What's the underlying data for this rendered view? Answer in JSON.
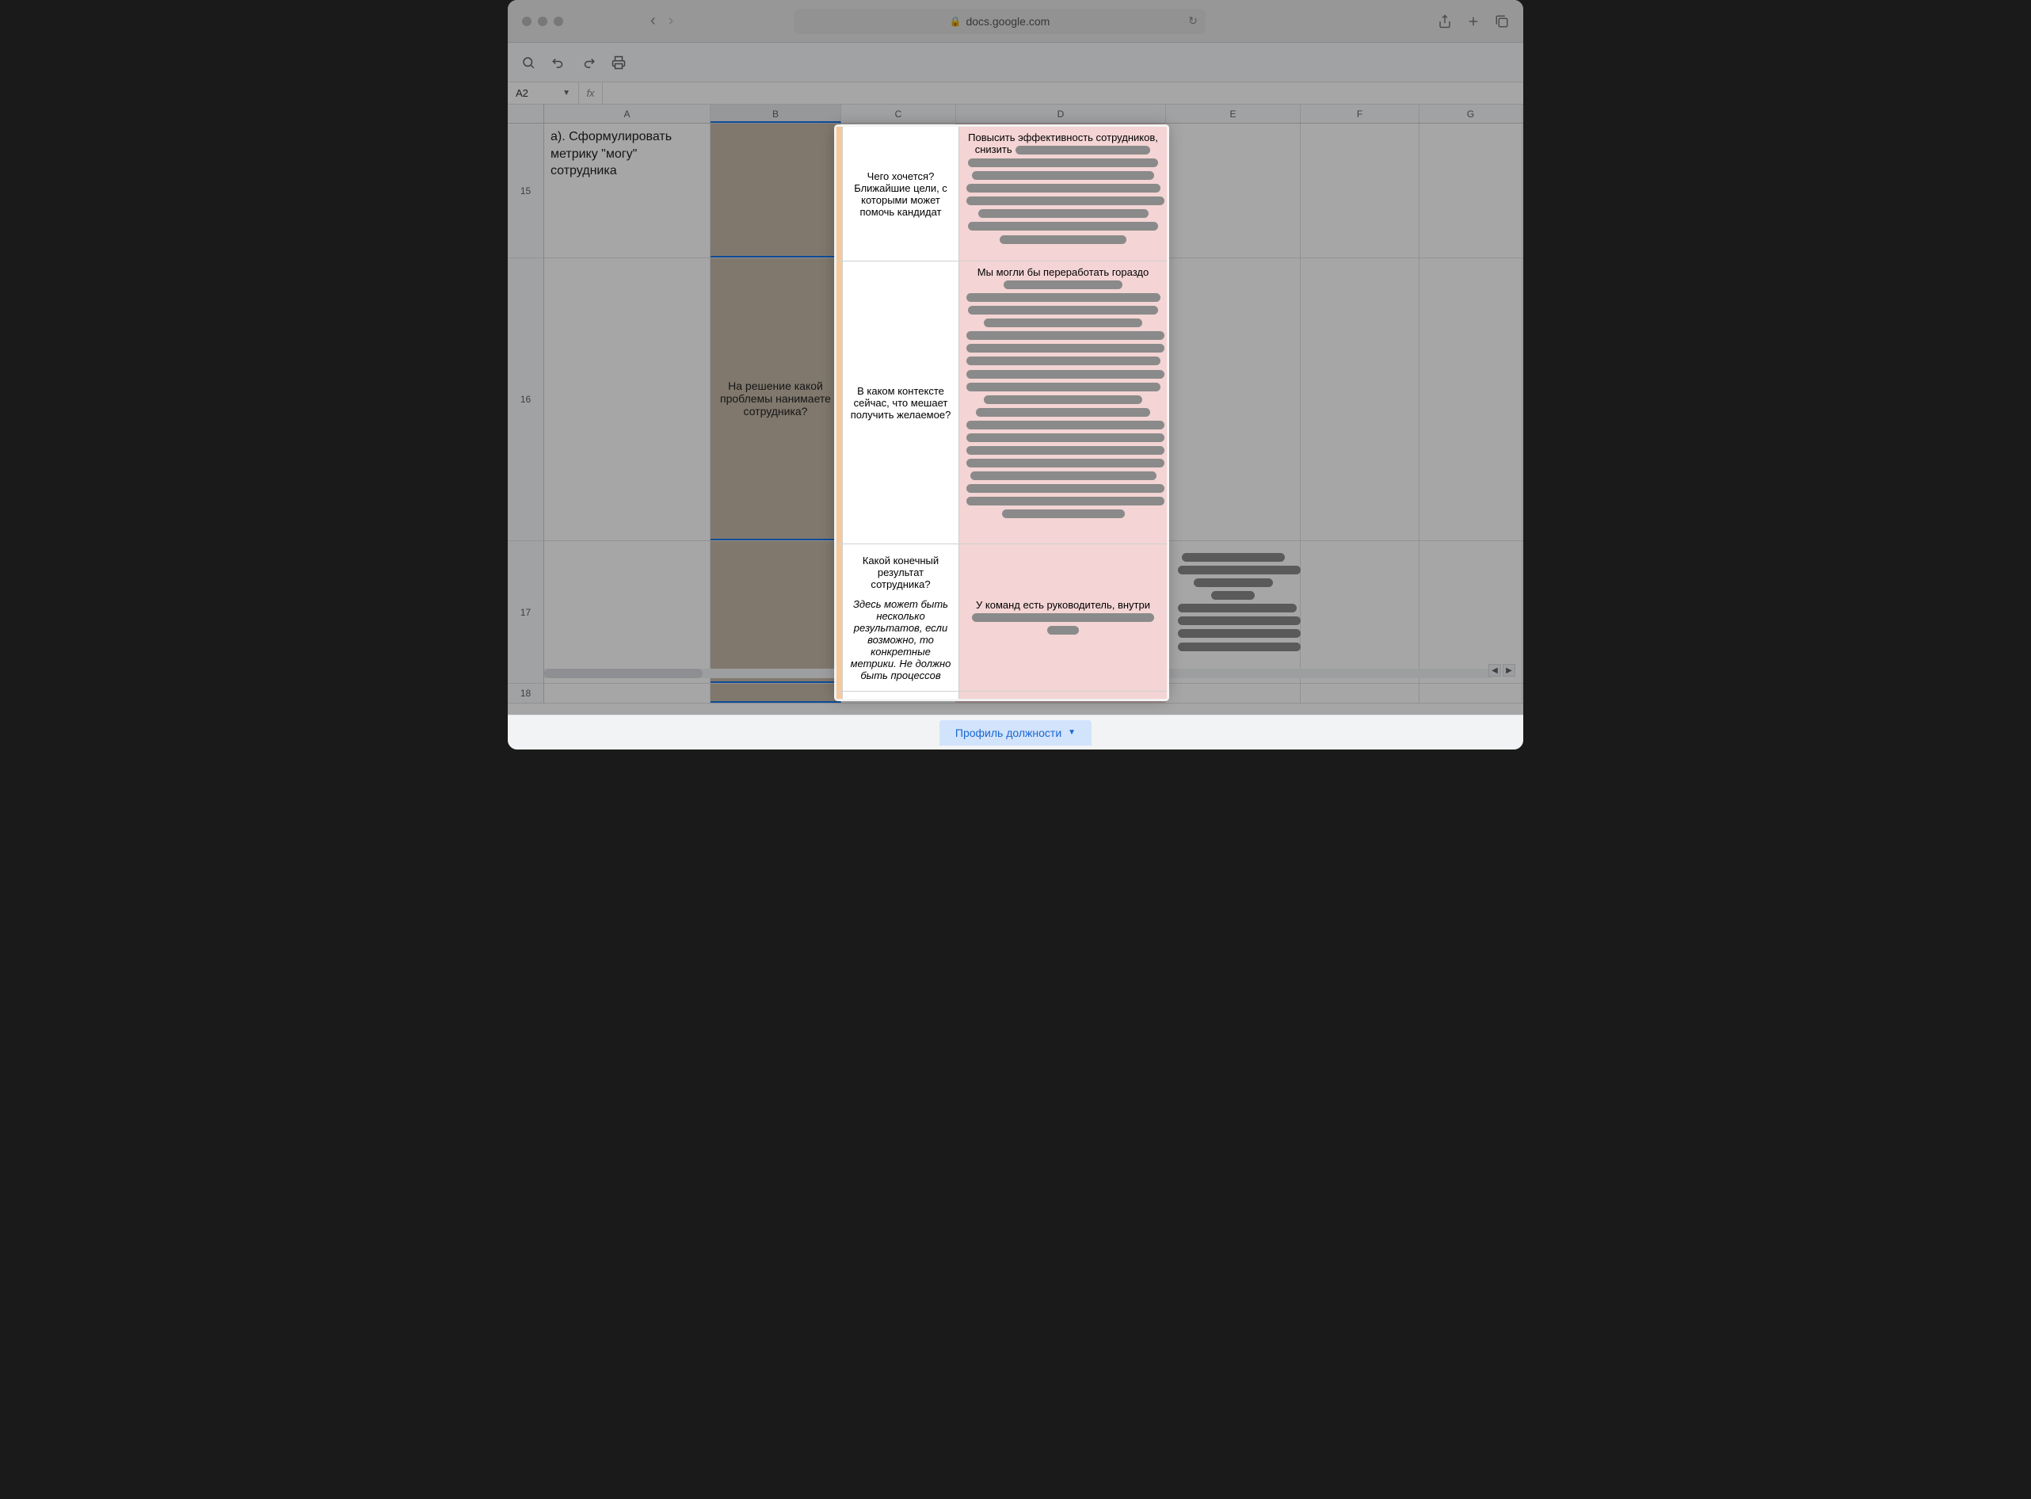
{
  "browser": {
    "url": "docs.google.com"
  },
  "namebox": {
    "ref": "A2"
  },
  "columns": [
    "A",
    "B",
    "C",
    "D",
    "E",
    "F",
    "G"
  ],
  "rows": [
    "15",
    "16",
    "17",
    "18"
  ],
  "cells": {
    "a15": "a). Сформулировать метрику \"могу\" сотрудника",
    "b16": "На решение какой проблемы нанимаете сотрудника?",
    "c15": "Чего хочется? Ближайшие цели, с которыми может помочь кандидат",
    "c16": "В каком контексте сейчас, что мешает получить желаемое?",
    "c17_main": "Какой конечный результат сотрудника?",
    "c17_italic": "Здесь может быть несколько результатов, если возможно, то конкретные метрики. Не должно быть процессов",
    "d15_lead": "Повысить эффективность сотрудников, снизить",
    "d16_lead": "Мы могли бы переработать гораздо",
    "d17_lead": "У команд есть руководитель, внутри"
  },
  "tab": {
    "label": "Профиль должности"
  }
}
